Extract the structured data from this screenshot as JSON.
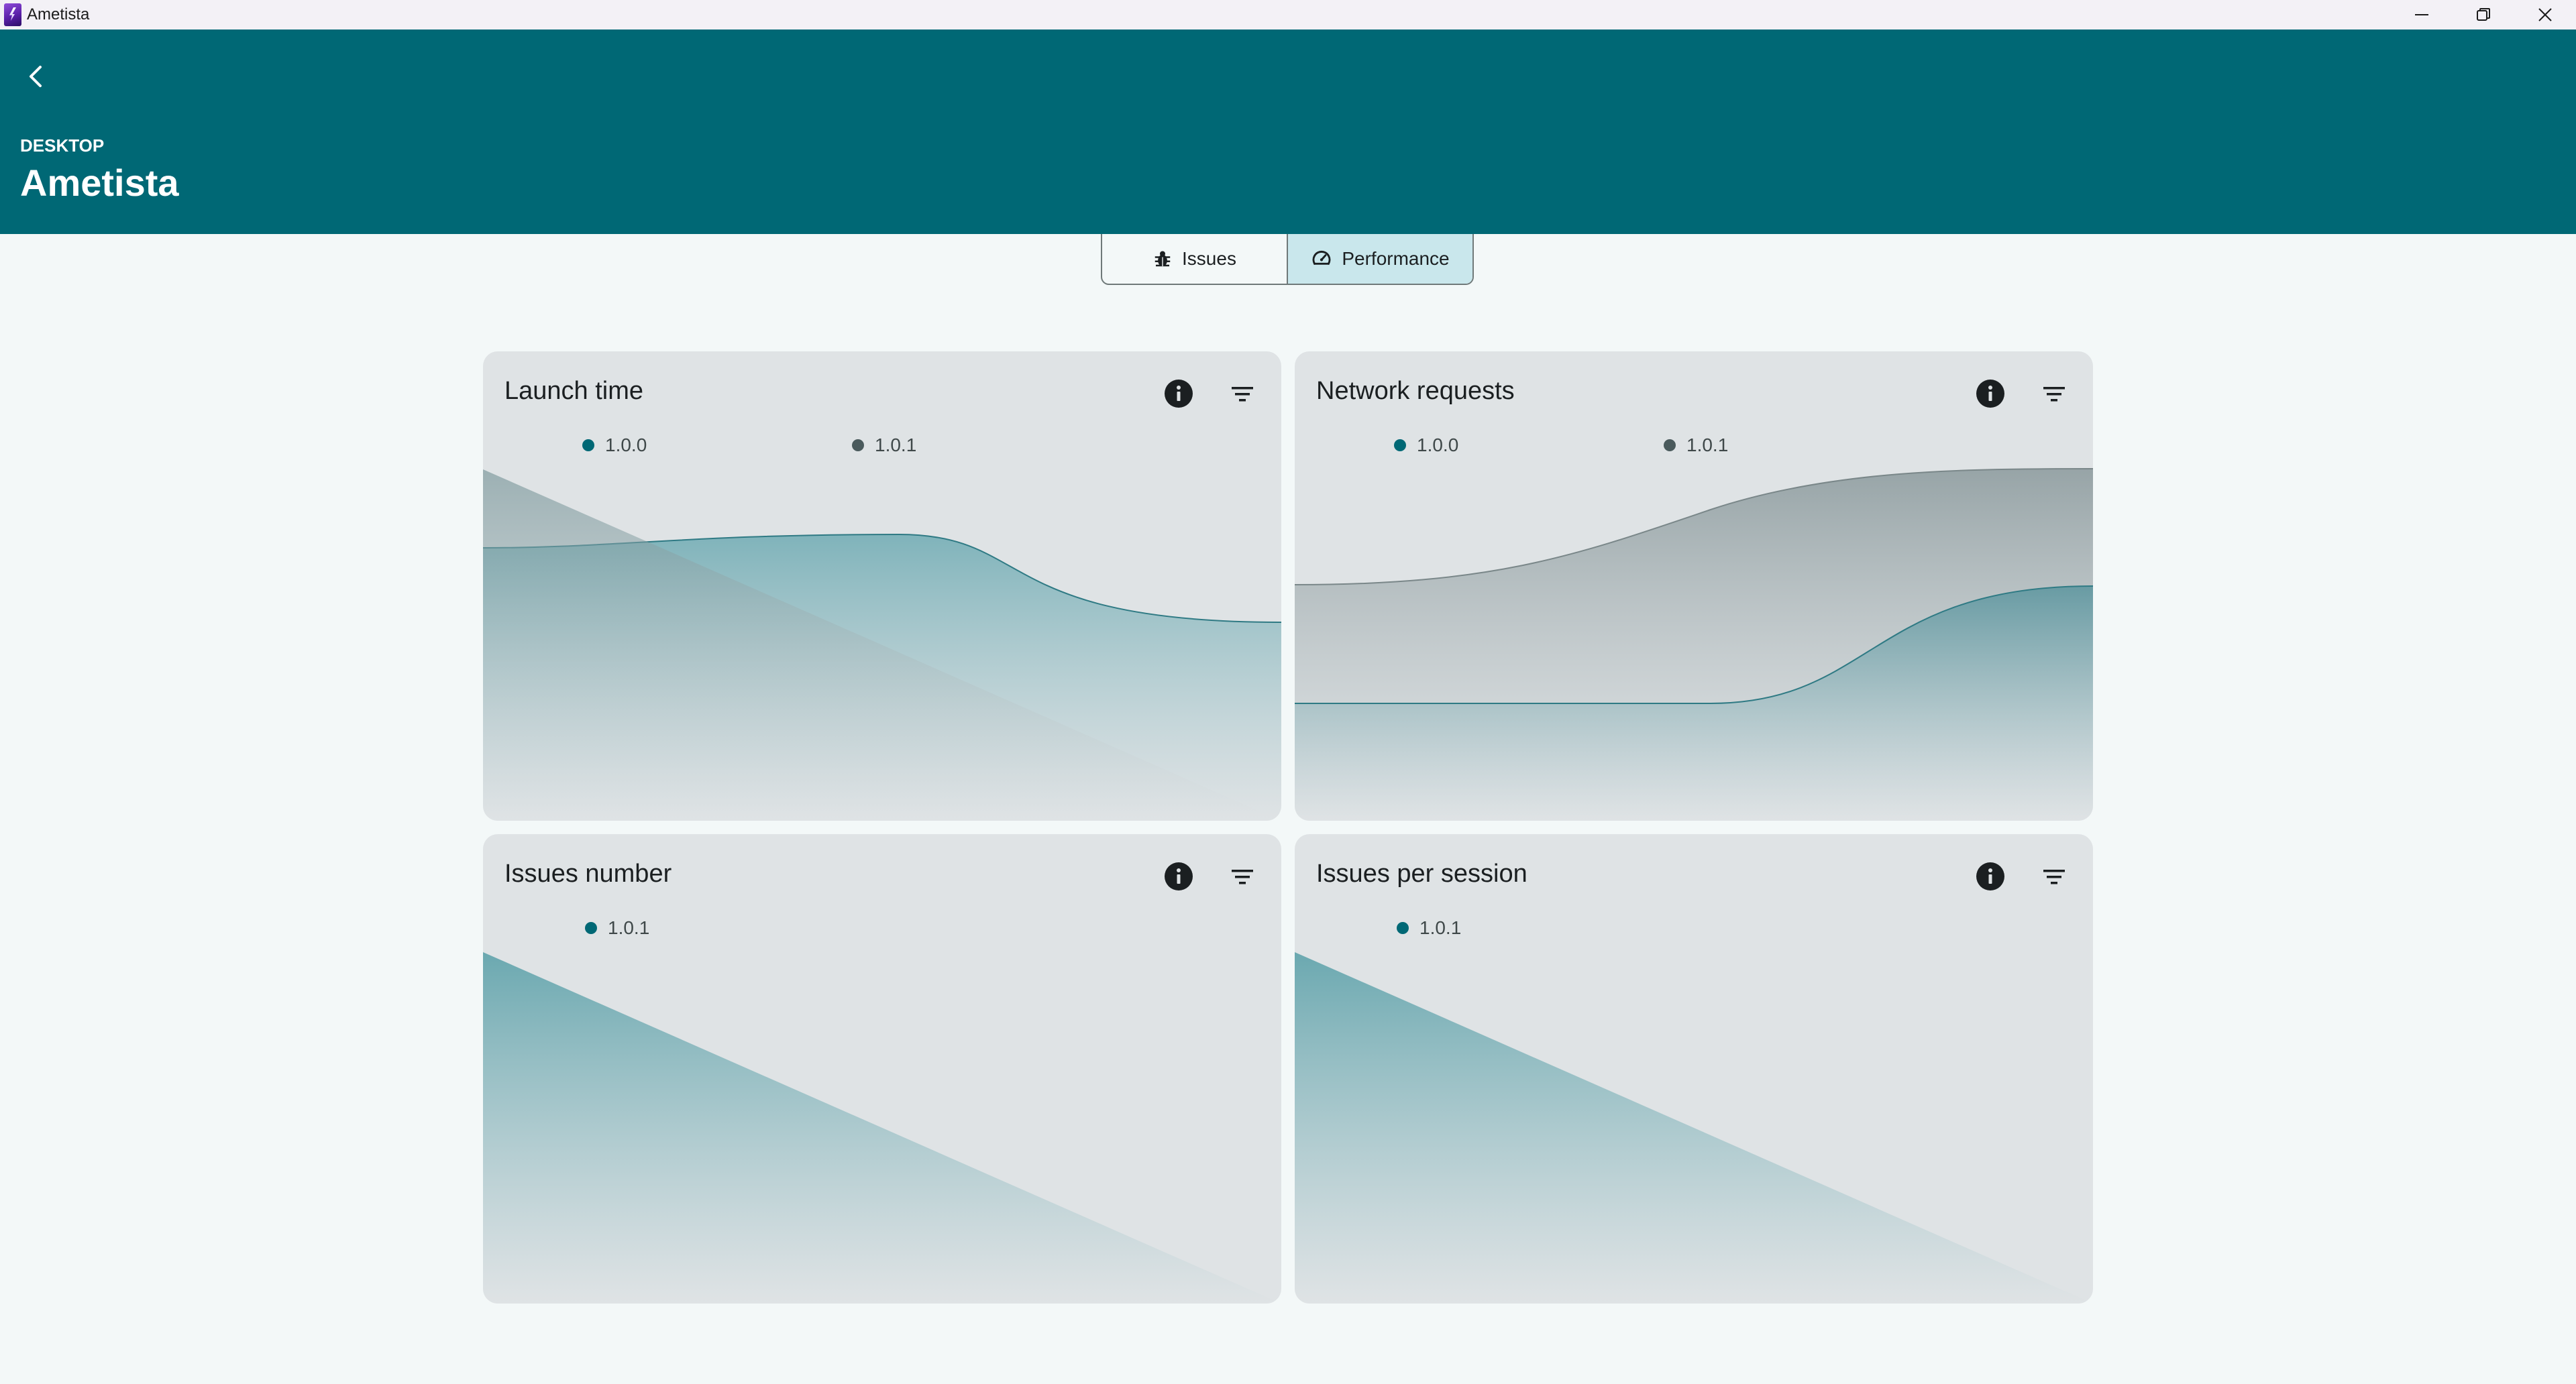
{
  "window": {
    "title": "Ametista",
    "controls": [
      "minimize-icon",
      "restore-icon",
      "close-icon"
    ]
  },
  "header": {
    "platform": "DESKTOP",
    "app_name": "Ametista",
    "background": "#006875"
  },
  "tabs": [
    {
      "label": "Issues",
      "icon": "bug-icon",
      "active": false
    },
    {
      "label": "Performance",
      "icon": "speedometer-icon",
      "active": true
    }
  ],
  "colors": {
    "series_primary": "#006875",
    "series_secondary": "#4a5a5c",
    "card_background": "#dfe3e5",
    "page_background": "#f3f8f8"
  },
  "cards": [
    {
      "title": "Launch time",
      "legend": [
        {
          "label": "1.0.0",
          "color": "#006875"
        },
        {
          "label": "1.0.1",
          "color": "#4a5a5c"
        }
      ]
    },
    {
      "title": "Network requests",
      "legend": [
        {
          "label": "1.0.0",
          "color": "#006875"
        },
        {
          "label": "1.0.1",
          "color": "#4a5a5c"
        }
      ]
    },
    {
      "title": "Issues number",
      "legend": [
        {
          "label": "1.0.1",
          "color": "#006875"
        }
      ]
    },
    {
      "title": "Issues per session",
      "legend": [
        {
          "label": "1.0.1",
          "color": "#006875"
        }
      ]
    }
  ],
  "chart_data": [
    {
      "type": "area",
      "title": "Launch time",
      "series": [
        {
          "name": "1.0.0",
          "values": [
            0.58,
            0.6,
            0.61,
            0.4
          ],
          "color": "#006875"
        },
        {
          "name": "1.0.1",
          "values": [
            0.75,
            0.0
          ],
          "color": "#4a5a5c"
        }
      ]
    },
    {
      "type": "area",
      "title": "Network requests",
      "series": [
        {
          "name": "1.0.0",
          "values": [
            0.25,
            0.25,
            0.25,
            0.5
          ],
          "color": "#006875"
        },
        {
          "name": "1.0.1",
          "values": [
            0.5,
            0.55,
            0.72,
            0.75
          ],
          "color": "#4a5a5c"
        }
      ]
    },
    {
      "type": "area",
      "title": "Issues number",
      "series": [
        {
          "name": "1.0.1",
          "values": [
            0.75,
            0.0
          ],
          "color": "#006875"
        }
      ]
    },
    {
      "type": "area",
      "title": "Issues per session",
      "series": [
        {
          "name": "1.0.1",
          "values": [
            0.75,
            0.0
          ],
          "color": "#006875"
        }
      ]
    }
  ]
}
